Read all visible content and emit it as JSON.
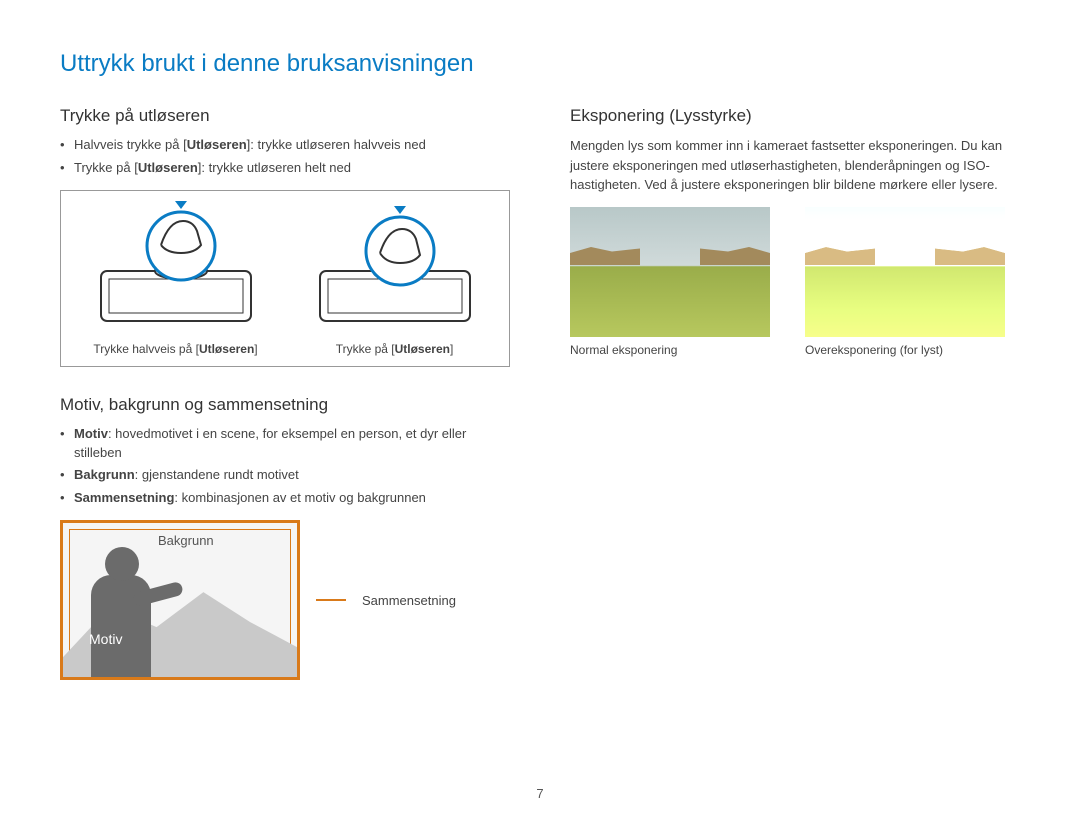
{
  "page_title": "Uttrykk brukt i denne bruksanvisningen",
  "page_number": "7",
  "left": {
    "section1_heading": "Trykke på utløseren",
    "section1_bullets": [
      {
        "prefix": "Halvveis trykke på [",
        "bold": "Utløseren",
        "suffix": "]: trykke utløseren halvveis ned"
      },
      {
        "prefix": "Trykke på [",
        "bold": "Utløseren",
        "suffix": "]: trykke utløseren helt ned"
      }
    ],
    "caption_half_a": "Trykke halvveis på [",
    "caption_half_b": "Utløseren",
    "caption_half_c": "]",
    "caption_full_a": "Trykke på [",
    "caption_full_b": "Utløseren",
    "caption_full_c": "]",
    "section2_heading": "Motiv, bakgrunn og sammensetning",
    "section2_bullets": [
      {
        "lead": "Motiv",
        "rest": ": hovedmotivet i en scene, for eksempel en person, et dyr eller stilleben"
      },
      {
        "lead": "Bakgrunn",
        "rest": ": gjenstandene rundt motivet"
      },
      {
        "lead": "Sammensetning",
        "rest": ": kombinasjonen av et motiv og bakgrunnen"
      }
    ],
    "comp_labels": {
      "bakgrunn": "Bakgrunn",
      "motiv": "Motiv",
      "sammensetning": "Sammensetning"
    }
  },
  "right": {
    "section_heading": "Eksponering (Lysstyrke)",
    "paragraph": "Mengden lys som kommer inn i kameraet fastsetter eksponeringen. Du kan justere eksponeringen med utløserhastigheten, blenderåpningen og ISO-hastigheten. Ved å justere eksponeringen blir bildene mørkere eller lysere.",
    "photo1_caption": "Normal eksponering",
    "photo2_caption": "Overeksponering (for lyst)"
  }
}
